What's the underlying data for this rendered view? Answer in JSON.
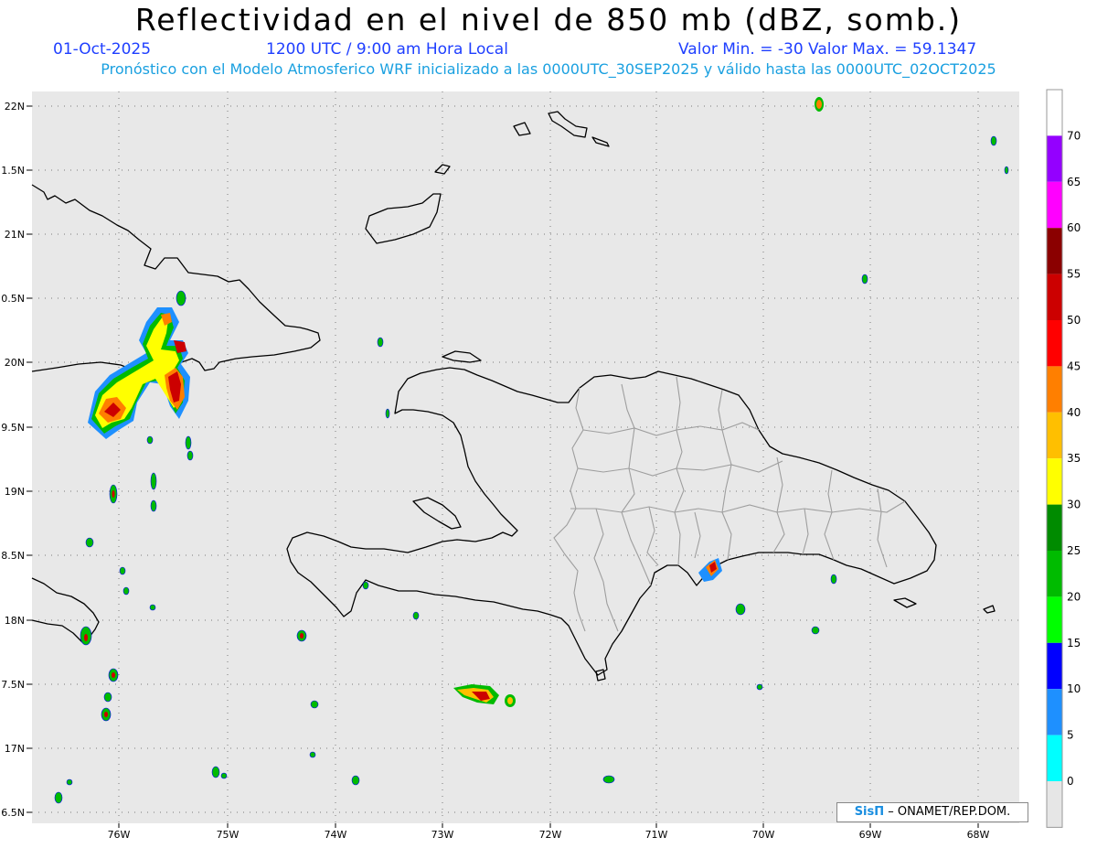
{
  "header": {
    "title": "Reflectividad en el nivel de 850 mb (dBZ, somb.)",
    "date": "01-Oct-2025",
    "time": "1200 UTC / 9:00 am Hora Local",
    "minmax": "Valor Min. = -30  Valor Max. = 59.1347",
    "forecast": "Pronóstico con el Modelo Atmosferico WRF inicializado a las 0000UTC_30SEP2025 y válido hasta las  0000UTC_02OCT2025"
  },
  "axes": {
    "lat_labels": [
      "22N",
      "1.5N",
      "21N",
      "0.5N",
      "20N",
      "9.5N",
      "19N",
      "8.5N",
      "18N",
      "7.5N",
      "17N",
      "6.5N"
    ],
    "lon_labels": [
      "76W",
      "75W",
      "74W",
      "73W",
      "72W",
      "71W",
      "70W",
      "69W",
      "68W"
    ]
  },
  "colorbar": {
    "labels": [
      "70",
      "65",
      "60",
      "55",
      "50",
      "45",
      "40",
      "35",
      "30",
      "25",
      "20",
      "15",
      "10",
      "5",
      "0"
    ],
    "colors": [
      "#ffffff",
      "#9400ff",
      "#ff00ff",
      "#8b0000",
      "#cc0000",
      "#ff0000",
      "#ff7f00",
      "#ffbf00",
      "#ffff00",
      "#008b00",
      "#00bb00",
      "#00ff00",
      "#0000ff",
      "#1e90ff",
      "#00ffff",
      "#e6e6e6"
    ]
  },
  "credit": {
    "logo": "SisΠ",
    "org": "– ONAMET/REP.DOM."
  }
}
